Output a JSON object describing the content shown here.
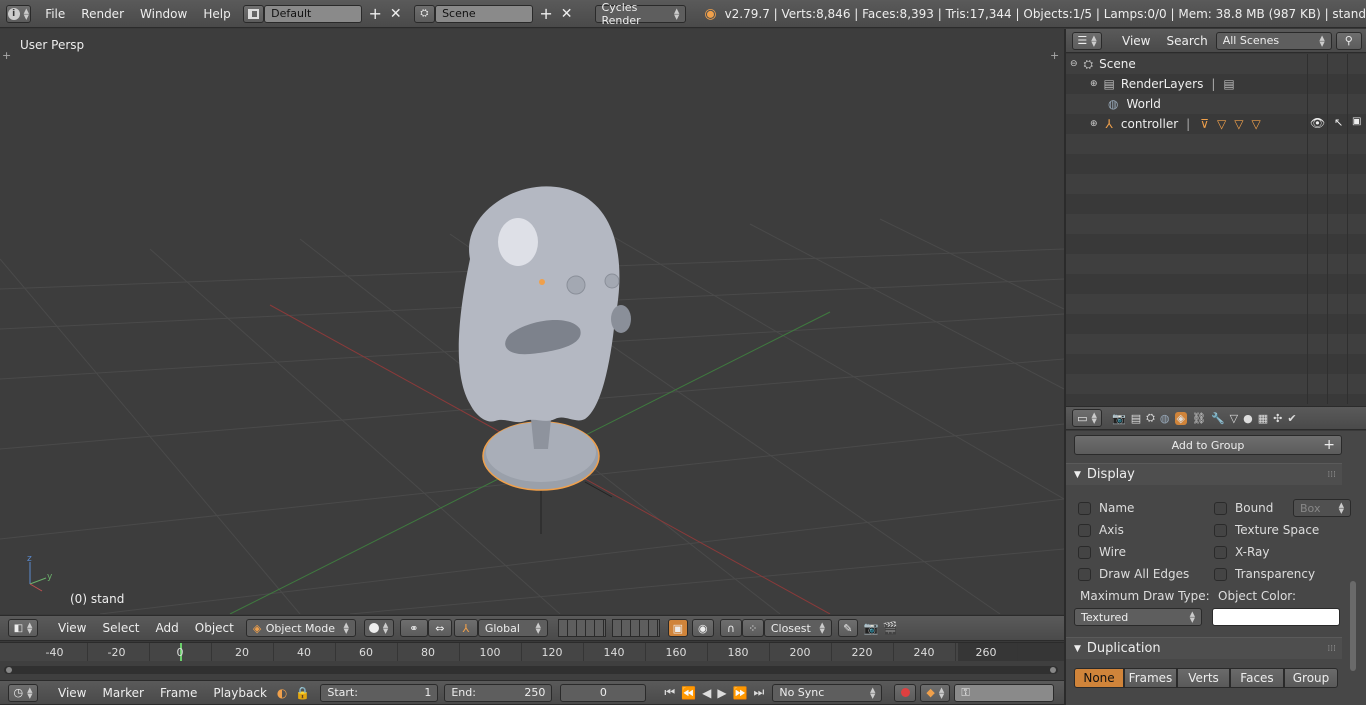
{
  "topbar": {
    "menus": [
      "File",
      "Render",
      "Window",
      "Help"
    ],
    "layout": "Default",
    "scene": "Scene",
    "engine": "Cycles Render",
    "stats": "v2.79.7 | Verts:8,846 | Faces:8,393 | Tris:17,344 | Objects:1/5 | Lamps:0/0 | Mem: 38.8 MB (987 KB) | stand"
  },
  "viewport": {
    "label": "User Persp",
    "object_label": "(0) stand"
  },
  "view_header": {
    "menus": [
      "View",
      "Select",
      "Add",
      "Object"
    ],
    "mode": "Object Mode",
    "orientation": "Global",
    "snap": "Closest"
  },
  "timeline": {
    "ticks": [
      "-40",
      "-20",
      "0",
      "20",
      "40",
      "60",
      "80",
      "100",
      "120",
      "140",
      "160",
      "180",
      "200",
      "220",
      "240",
      "260"
    ],
    "menus": [
      "View",
      "Marker",
      "Frame",
      "Playback"
    ],
    "start_label": "Start:",
    "start": "1",
    "end_label": "End:",
    "end": "250",
    "current": "0",
    "sync": "No Sync"
  },
  "outliner": {
    "menus": [
      "View",
      "Search"
    ],
    "filter": "All Scenes",
    "items": [
      {
        "label": "Scene",
        "indent": 0
      },
      {
        "label": "RenderLayers",
        "indent": 1
      },
      {
        "label": "World",
        "indent": 1
      },
      {
        "label": "controller",
        "indent": 1
      }
    ]
  },
  "properties": {
    "add_to_group": "Add to Group",
    "display": {
      "title": "Display",
      "left": [
        "Name",
        "Axis",
        "Wire",
        "Draw All Edges"
      ],
      "right": [
        "Bound",
        "Texture Space",
        "X-Ray",
        "Transparency"
      ],
      "bound_type": "Box",
      "max_draw_label": "Maximum Draw Type:",
      "max_draw": "Textured",
      "object_color_label": "Object Color:"
    },
    "duplication": {
      "title": "Duplication",
      "tabs": [
        "None",
        "Frames",
        "Verts",
        "Faces",
        "Group"
      ]
    }
  },
  "colors": {
    "accent": "#f0a04b",
    "selected_tab": "#d0843a"
  }
}
